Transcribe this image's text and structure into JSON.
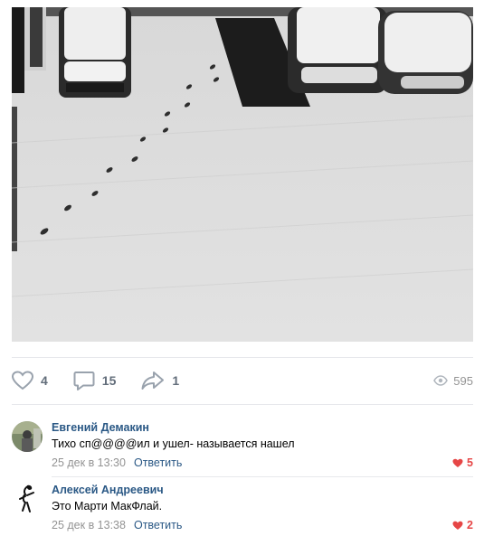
{
  "post": {
    "photo": {
      "description_icon": "snowy-parking-lot-photo"
    },
    "actions": {
      "likes": "4",
      "comments": "15",
      "shares": "1",
      "views": "595"
    }
  },
  "comments": [
    {
      "author": "Евгений Демакин",
      "text": "Тихо сп@@@@ил и ушел- называется нашел",
      "date": "25 дек в 13:30",
      "reply_label": "Ответить",
      "likes": "5"
    },
    {
      "author": "Алексей Андреевич",
      "text": "Это Марти МакФлай.",
      "date": "25 дек в 13:38",
      "reply_label": "Ответить",
      "likes": "2"
    }
  ],
  "colors": {
    "link": "#2a5885",
    "muted": "#939393",
    "action_icon": "#99a2ad",
    "like_red": "#e64646"
  }
}
